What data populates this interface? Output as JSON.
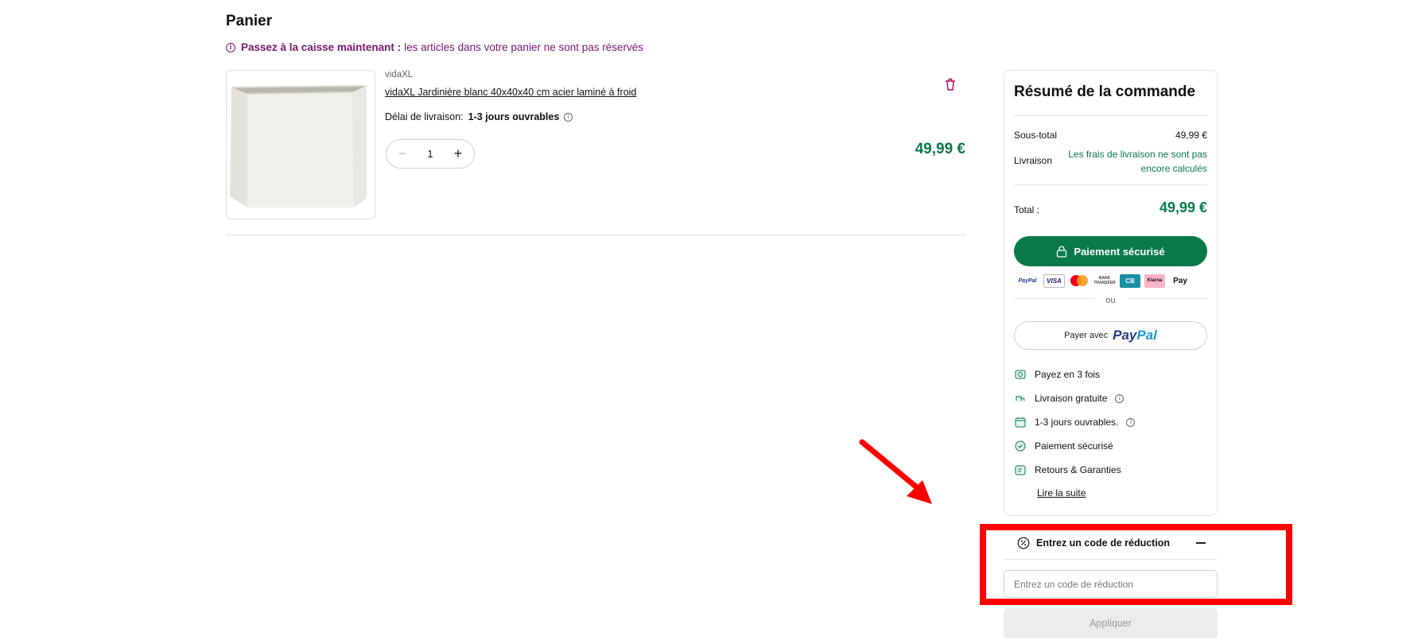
{
  "cart": {
    "title": "Panier",
    "notice_bold": "Passez à la caisse maintenant :",
    "notice_text": "les articles dans votre panier ne sont pas réservés"
  },
  "product": {
    "brand": "vidaXL",
    "name": "vidaXL Jardinière blanc 40x40x40 cm acier laminé à froid",
    "delivery_label": "Délai de livraison:",
    "delivery_value": "1-3 jours ouvrables",
    "quantity": "1",
    "price": "49,99 €"
  },
  "summary": {
    "title": "Résumé de la commande",
    "subtotal_label": "Sous-total",
    "subtotal_value": "49,99 €",
    "shipping_label": "Livraison",
    "shipping_value": "Les frais de livraison ne sont pas encore calculés",
    "total_label": "Total :",
    "total_value": "49,99 €",
    "pay_button": "Paiement sécurisé",
    "payment_methods": {
      "paypal": "PayPal",
      "visa": "VISA",
      "bank": "BANK TRANSFER",
      "cb": "CB",
      "klarna": "Klarna",
      "apple": "Pay"
    },
    "or": "ou",
    "paypal_prefix": "Payer avec",
    "paypal_brand_1": "Pay",
    "paypal_brand_2": "Pal",
    "features": [
      "Payez en 3 fois",
      "Livraison gratuite",
      "1-3 jours ouvrables.",
      "Paiement sécurisé",
      "Retours & Garanties"
    ],
    "read_more": "Lire la suite"
  },
  "discount": {
    "title": "Entrez un code de réduction",
    "placeholder": "Entrez un code de réduction",
    "apply_button": "Appliquer"
  },
  "colors": {
    "brand_green": "#0b7a4b",
    "notice_purple": "#7a1773",
    "annotation_red": "#ff0000"
  }
}
